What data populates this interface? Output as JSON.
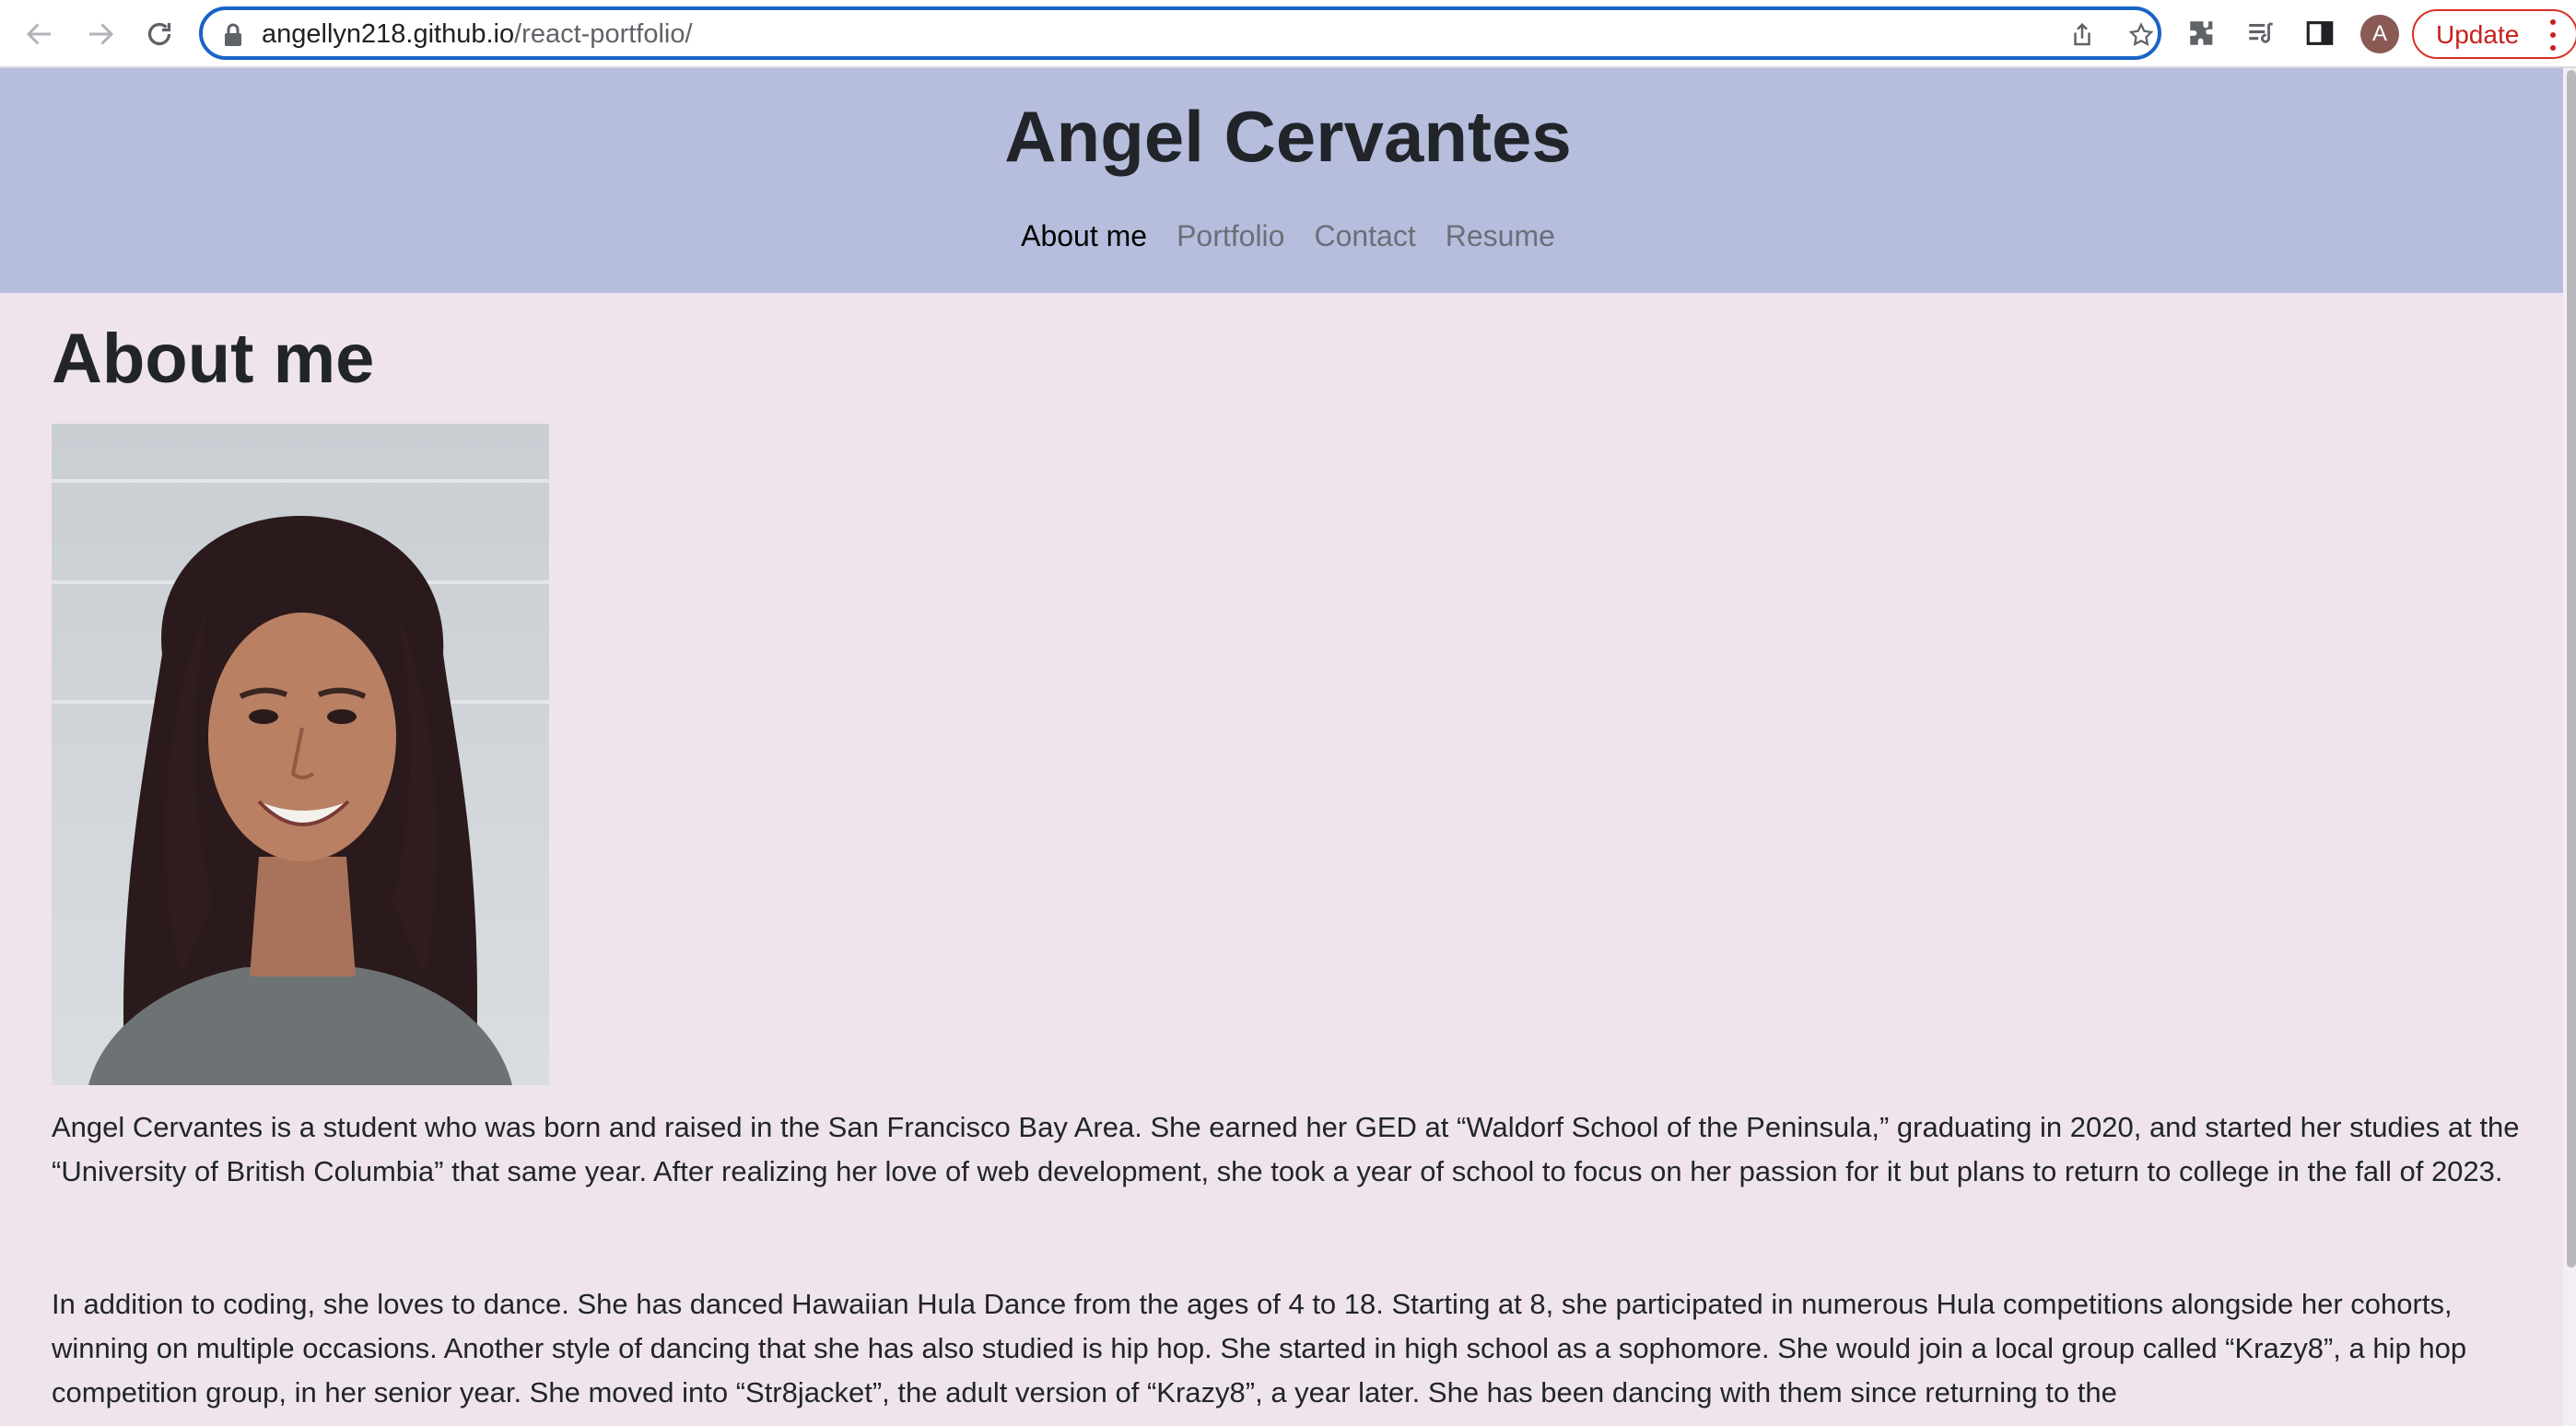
{
  "browser": {
    "url_host": "angellyn218.github.io",
    "url_path": "/react-portfolio/",
    "profile_initial": "A",
    "update_label": "Update"
  },
  "header": {
    "site_title": "Angel Cervantes",
    "nav": [
      "About me",
      "Portfolio",
      "Contact",
      "Resume"
    ],
    "active_nav": "About me"
  },
  "main": {
    "heading": "About me",
    "paragraphs": [
      "Angel Cervantes is a student who was born and raised in the San Francisco Bay Area. She earned her GED at “Waldorf School of the Peninsula,” graduating in 2020, and started her studies at the “University of British Columbia” that same year. After realizing her love of web development, she took a year of school to focus on her passion for it but plans to return to college in the fall of 2023.",
      "In addition to coding, she loves to dance. She has danced Hawaiian Hula Dance from the ages of 4 to 18. Starting at 8, she participated in numerous Hula competitions alongside her cohorts, winning on multiple occasions. Another style of dancing that she has also studied is hip hop. She started in high school as a sophomore. She would join a local group called “Krazy8”, a hip hop competition group, in her senior year. She moved into “Str8jacket”, the adult version of “Krazy8”, a year later. She has been dancing with them since returning to the"
    ]
  },
  "colors": {
    "header_bg": "#b7bddd",
    "page_bg": "#efe4ee",
    "text": "#212529",
    "nav_inactive": "#6c6e78",
    "omnibox_focus": "#1a63c7",
    "update_red": "#d93025"
  }
}
